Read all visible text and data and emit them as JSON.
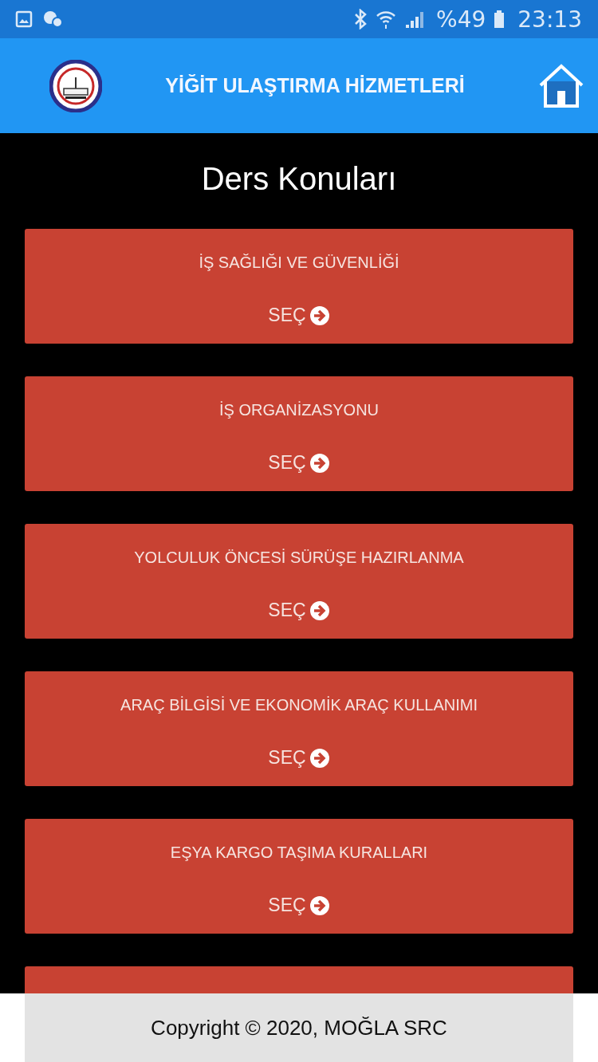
{
  "status_bar": {
    "battery": "%49",
    "time": "23:13"
  },
  "app_bar": {
    "title": "YİĞİT ULAŞTIRMA HİZMETLERİ"
  },
  "page_title": "Ders Konuları",
  "topics": [
    {
      "title": "İŞ SAĞLIĞI VE GÜVENLİĞİ",
      "action": "SEÇ"
    },
    {
      "title": "İŞ ORGANİZASYONU",
      "action": "SEÇ"
    },
    {
      "title": "YOLCULUK ÖNCESİ SÜRÜŞE HAZIRLANMA",
      "action": "SEÇ"
    },
    {
      "title": "ARAÇ BİLGİSİ VE EKONOMİK ARAÇ KULLANIMI",
      "action": "SEÇ"
    },
    {
      "title": "EŞYA KARGO TAŞIMA KURALLARI",
      "action": "SEÇ"
    }
  ],
  "covered_card": true,
  "footer": "Copyright © 2020, MOĞLA SRC"
}
